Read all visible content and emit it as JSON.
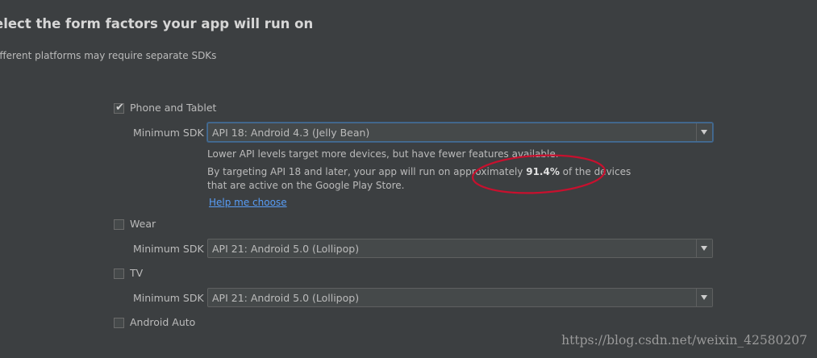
{
  "header": {
    "title": "elect the form factors your app will run on",
    "subtitle": "ifferent platforms may require separate SDKs"
  },
  "form_factors": [
    {
      "label": "Phone and Tablet",
      "checked": true,
      "min_sdk_label": "Minimum SDK",
      "min_sdk_value": "API 18: Android 4.3 (Jelly Bean)"
    },
    {
      "label": "Wear",
      "checked": false,
      "min_sdk_label": "Minimum SDK",
      "min_sdk_value": "API 21: Android 5.0 (Lollipop)"
    },
    {
      "label": "TV",
      "checked": false,
      "min_sdk_label": "Minimum SDK",
      "min_sdk_value": "API 21: Android 5.0 (Lollipop)"
    },
    {
      "label": "Android Auto",
      "checked": false
    }
  ],
  "phone_info": {
    "line1": "Lower API levels target more devices, but have fewer features available.",
    "line2_prefix": "By targeting API 18 and later, your app will run on approximately ",
    "line2_percent": "91.4%",
    "line2_suffix": " of the devices",
    "line3": "that are active on the Google Play Store.",
    "help_link": "Help me choose"
  },
  "annotation": {
    "shape": "ellipse",
    "color": "#c8102e"
  },
  "watermark": "https://blog.csdn.net/weixin_42580207",
  "colors": {
    "background": "#3c3f41",
    "text": "#bbbbbb",
    "link": "#589df6",
    "focus_border": "#466d94"
  }
}
